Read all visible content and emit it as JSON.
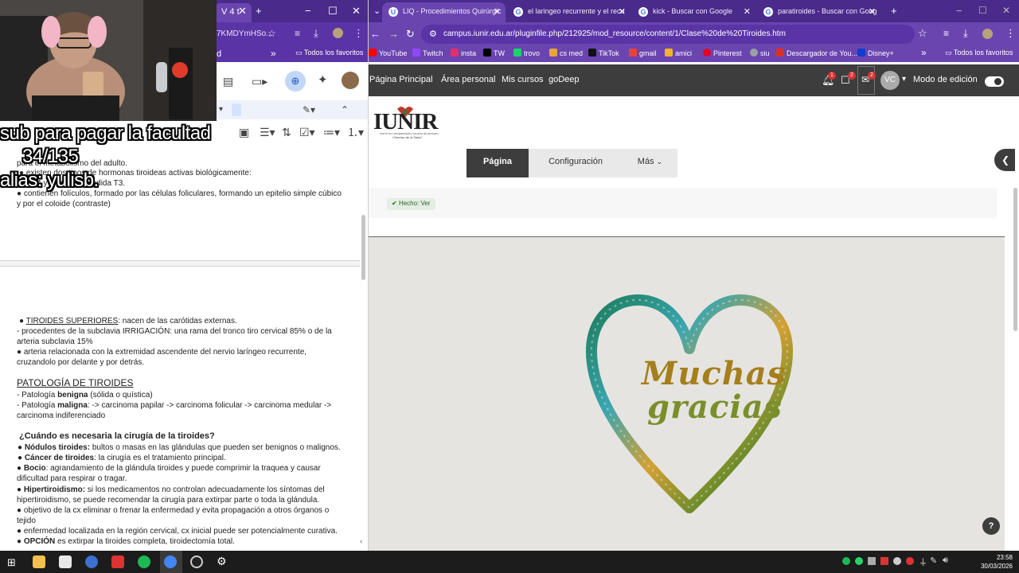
{
  "left_window": {
    "tab_fragment": "V 4 t",
    "url_fragment": "7KMDYmHSo...",
    "bookmarks_right": "Todos los favoritos",
    "bookmark_fragment": "d",
    "overlay": {
      "line1": "sub para pagar la facultad",
      "line2": "34/135",
      "line3": "alias: yulisb."
    },
    "doc_lines": {
      "l0": "para el metabolismo del adulto.",
      "l1": "● existen dos tipos de hormonas tiroideas activas biológicamente:",
      "l2": "T4 y en menor medida T3.",
      "l3": "● contienen folículos, formado por las células foliculares, formando un epitelio simple cúbico",
      "l4": "y por el coloide (contraste)",
      "l5a": "TIROIDES SUPERIORES",
      "l5b": ": nacen de las carótidas externas.",
      "l6": "- procedentes de la subclavia IRRIGACIÓN: una rama del tronco tiro cervical 85% o de la",
      "l7": "arteria subclavia 15%",
      "l8": "● arteria relacionada con la extremidad ascendente del nervio laríngeo recurrente,",
      "l9": "cruzandolo por delante y por detrás.",
      "h1": "PATOLOGÍA DE TIROIDES",
      "l10a": " - Patología ",
      "l10b": "benigna",
      "l10c": " (sólida o quística)",
      "l11a": "- Patología ",
      "l11b": "maligna",
      "l11c": ": -> carcinoma papilar -> carcinoma folicular -> carcinoma medular ->",
      "l12": "carcinoma indiferenciado",
      "h2": "¿Cuándo es necesaria la cirugía de la tiroides?",
      "l13a": "● Nódulos tiroides:",
      "l13b": " bultos o masas en las glándulas que pueden ser benignos o malignos.",
      "l14a": "● Cáncer de tiroides",
      "l14b": ": la cirugía es el tratamiento principal.",
      "l15a": "● Bocio",
      "l15b": ": agrandamiento de la glándula tiroides y puede comprimir la traquea y causar",
      "l16": "dificultad para respirar o tragar.",
      "l17a": "● Hipertiroidismo:",
      "l17b": " si los medicamentos no controlan adecuadamente los síntomas del",
      "l18": "hipertiroidismo, se puede recomendar la cirugía para extirpar parte o toda la glándula.",
      "l19": "● objetivo de la cx eliminar o frenar la enfermedad y evita propagación a otros órganos o",
      "l20": "tejido",
      "l21": "● enfermedad localizada en la región cervical, cx inicial puede ser potencialmente curativa.",
      "l22a": "● OPCIÓN",
      "l22b": " es extirpar la tiroides completa, tiroidectomía total."
    }
  },
  "browser": {
    "tabs": [
      {
        "label": "LIQ - Procedimientos Quirúrgic",
        "favicon": "U"
      },
      {
        "label": "el laringeo recurrente y el recu",
        "favicon": "G"
      },
      {
        "label": "kick - Buscar con Google",
        "favicon": "G"
      },
      {
        "label": "paratiroides - Buscar con Goog",
        "favicon": "G"
      }
    ],
    "url": "campus.iunir.edu.ar/pluginfile.php/212925/mod_resource/content/1/Clase%20de%20Tiroides.htm",
    "bookmarks": [
      {
        "label": "YouTube",
        "color": "#ff0000"
      },
      {
        "label": "Twitch",
        "color": "#9146ff"
      },
      {
        "label": "insta",
        "color": "#e1306c"
      },
      {
        "label": "TW",
        "color": "#000000"
      },
      {
        "label": "trovo",
        "color": "#19d66b"
      },
      {
        "label": "cs med",
        "color": "#e8a33d"
      },
      {
        "label": "TikTok",
        "color": "#111111"
      },
      {
        "label": "gmail",
        "color": "#ea4335"
      },
      {
        "label": "amici",
        "color": "#f2b233"
      },
      {
        "label": "Pinterest",
        "color": "#e60023"
      },
      {
        "label": "siu",
        "color": "#9aa0a6"
      },
      {
        "label": "Descargador de You...",
        "color": "#d93025"
      },
      {
        "label": "Disney+",
        "color": "#113ccf"
      }
    ],
    "bookmarks_all": "Todos los favoritos"
  },
  "site": {
    "nav": [
      "Página Principal",
      "Área personal",
      "Mis cursos",
      "goDeep"
    ],
    "badges": {
      "bell": "1",
      "chat": "2",
      "mail": "2"
    },
    "avatar_initials": "VC",
    "edit_mode_label": "Modo de edición",
    "logo_text": "IUNIR",
    "logo_sub": "INSTITUTO UNIVERSITARIO ITALIANO DE ROSARIO",
    "logo_sub2": "Ciencias de la Salud",
    "page_tabs": [
      "Página",
      "Configuración",
      "Más"
    ],
    "done_label": "Hecho: Ver",
    "image_text": {
      "line1": "Muchas",
      "line2": "gracias"
    }
  },
  "taskbar": {
    "time": "23:58",
    "date": "30/03/2026"
  }
}
